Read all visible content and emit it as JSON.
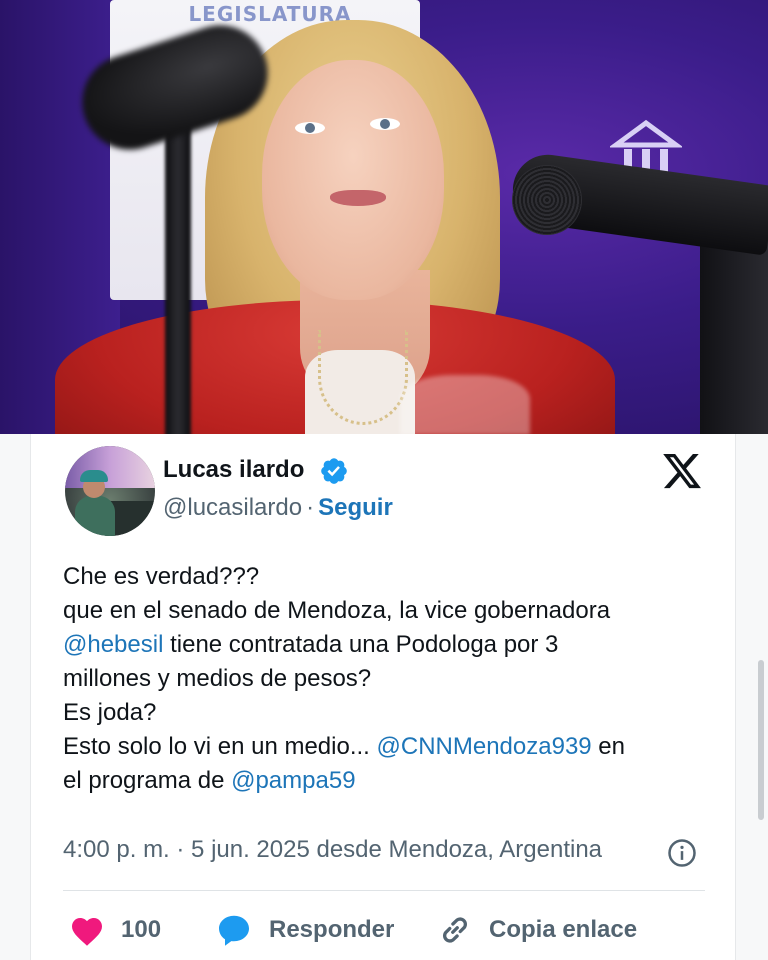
{
  "photo": {
    "sign_text": "LEGISLATURA",
    "description_icon": "legislature-logo-icon"
  },
  "tweet": {
    "author_name": "Lucas ilardo",
    "handle": "@lucasilardo",
    "separator": "·",
    "follow_label": "Seguir",
    "verified_icon": "verified-badge-icon",
    "platform_icon": "x-logo-icon",
    "body": {
      "line1": "Che es verdad???",
      "line2": "que en el senado de Mendoza, la vice gobernadora",
      "mention1": "@hebesil",
      "line3_rest": " tiene contratada una Podologa por 3",
      "line4": "millones y medios de pesos?",
      "line5": "Es joda?",
      "line6_start": "Esto solo lo vi en un medio... ",
      "mention2": "@CNNMendoza939",
      "line6_end": " en",
      "line7_start": "el programa de ",
      "mention3": "@pampa59"
    },
    "meta": "4:00 p. m. · 5 jun. 2025 desde Mendoza, Argentina",
    "info_icon": "info-icon"
  },
  "actions": {
    "like_count": "100",
    "reply_label": "Responder",
    "copy_label": "Copia enlace"
  },
  "colors": {
    "link": "#1d75b8",
    "like": "#f0197d",
    "text": "#0f1419",
    "muted": "#536471"
  }
}
